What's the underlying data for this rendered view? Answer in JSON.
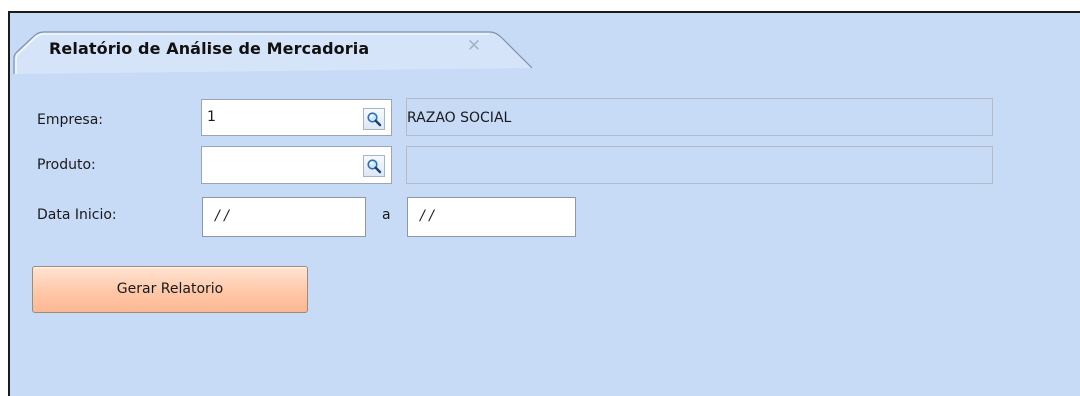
{
  "tab": {
    "title": "Relatório de Análise de Mercadoria",
    "close_glyph": "✕"
  },
  "form": {
    "empresa": {
      "label": "Empresa:",
      "code_value": "1",
      "description_value": "RAZAO SOCIAL",
      "lookup_icon": "magnifier-icon"
    },
    "produto": {
      "label": "Produto:",
      "code_value": "",
      "description_value": "",
      "lookup_icon": "magnifier-icon"
    },
    "data_inicio": {
      "label": "Data Inicio:",
      "start_value": " / /",
      "separator": "a",
      "end_value": " / /"
    }
  },
  "actions": {
    "generate_label": "Gerar Relatorio"
  },
  "colors": {
    "panel_background": "#c7dbf7",
    "button_gradient_top": "#ffe4d3",
    "button_gradient_bottom": "#fcb894"
  }
}
